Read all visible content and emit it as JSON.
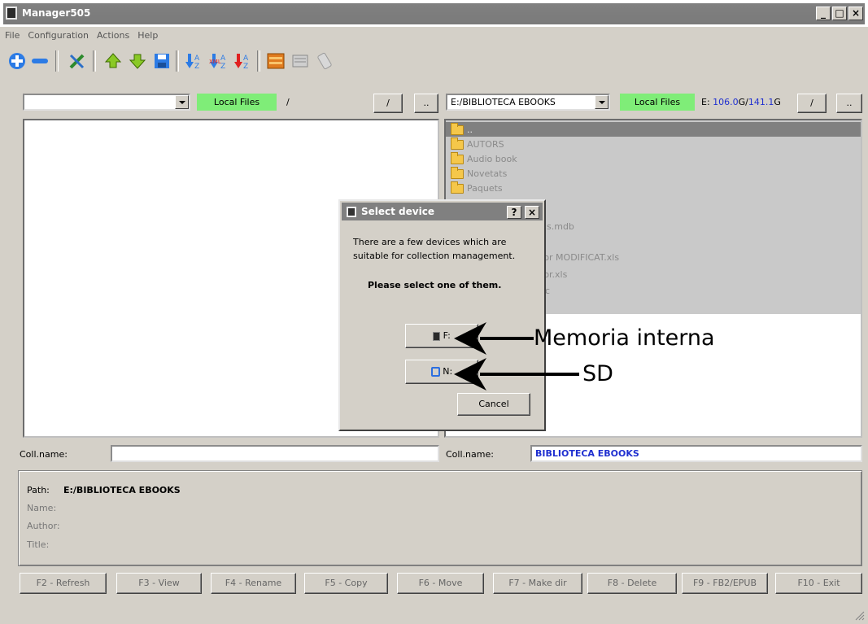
{
  "window": {
    "title": "Manager505",
    "controls": [
      "_",
      "□",
      "×"
    ]
  },
  "menu": [
    "File",
    "Configuration",
    "Actions",
    "Help"
  ],
  "toolbar": {
    "icons": [
      "add-icon",
      "remove-icon",
      "tools-icon",
      "up-arrow-icon",
      "down-arrow-icon",
      "save-icon",
      "sort-az-icon",
      "sort-xml-icon",
      "sort-za-icon",
      "database-icon",
      "books-icon",
      "device-icon"
    ]
  },
  "left_pane": {
    "combo_value": "",
    "source_button": "Local Files",
    "path": "/",
    "root_button": "/",
    "up_button": "..",
    "coll_label": "Coll.name:",
    "coll_value": ""
  },
  "right_pane": {
    "combo_value": "E:/BIBLIOTECA EBOOKS",
    "source_button": "Local Files",
    "drive_prefix": "E:",
    "free_space": "106.0",
    "free_unit": "G/",
    "total_space": "141.1",
    "total_unit": "G",
    "root_button": "/",
    "up_button": "..",
    "files": [
      "..",
      "AUTORS",
      "Audio book",
      "Novetats",
      "Paquets"
    ],
    "partial_items": [
      "s.mdb",
      "tor MODIFICAT.xls",
      "tor.xls",
      "c"
    ],
    "coll_label": "Coll.name:",
    "coll_value": "BIBLIOTECA EBOOKS"
  },
  "info": {
    "path_label": "Path:",
    "path_value": "E:/BIBLIOTECA EBOOKS",
    "name_label": "Name:",
    "author_label": "Author:",
    "title_label": "Title:"
  },
  "function_keys": [
    "F2 - Refresh",
    "F3 - View",
    "F4 - Rename",
    "F5 - Copy",
    "F6 - Move",
    "F7 - Make dir",
    "F8 - Delete",
    "F9 - FB2/EPUB",
    "F10 - Exit"
  ],
  "dialog": {
    "title": "Select device",
    "help": "?",
    "close": "×",
    "line1": "There are a few devices which are",
    "line2": "suitable for collection management.",
    "prompt": "Please select one of them.",
    "device_f": "F:",
    "device_n": "N:",
    "cancel": "Cancel"
  },
  "annotations": {
    "memory": "Memoria interna",
    "sd": "SD"
  },
  "colors": {
    "accent_blue": "#1f2fd0",
    "green_button": "#7fed78",
    "selection": "#808080"
  }
}
